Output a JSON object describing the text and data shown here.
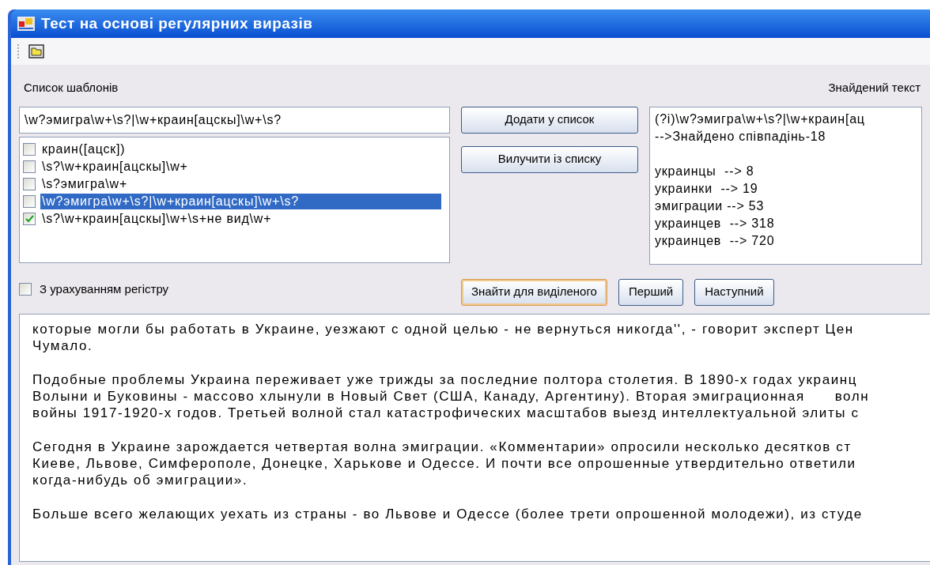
{
  "window": {
    "title": "Тест на основі регулярних виразів"
  },
  "templates": {
    "label": "Список шаблонів",
    "pattern_input": "\\w?эмигра\\w+\\s?|\\w+краин[ацскы]\\w+\\s?",
    "items": [
      {
        "text": "краин([ацск])",
        "checked": false,
        "selected": false
      },
      {
        "text": "\\s?\\w+краин[ацскы]\\w+",
        "checked": false,
        "selected": false
      },
      {
        "text": "\\s?эмигра\\w+",
        "checked": false,
        "selected": false
      },
      {
        "text": "\\w?эмигра\\w+\\s?|\\w+краин[ацскы]\\w+\\s?",
        "checked": false,
        "selected": true
      },
      {
        "text": "\\s?\\w+краин[ацскы]\\w+\\s+не вид\\w+",
        "checked": true,
        "selected": false
      }
    ]
  },
  "list_buttons": [
    "Додати у список",
    "Вилучити із списку"
  ],
  "case_sensitive": {
    "label": "З урахуванням регістру",
    "checked": false
  },
  "found": {
    "label": "Знайдений текст",
    "query_lines": [
      "(?i)\\w?эмигра\\w+\\s?|\\w+краин[ац",
      "-->Знайдено співпадінь-18"
    ],
    "results": [
      "украинцы  --> 8",
      "украинки  --> 19",
      "эмиграции --> 53",
      "украинцев  --> 318",
      "украинцев  --> 720"
    ]
  },
  "action_buttons": [
    {
      "label": "Знайти для виділеного",
      "focused": true
    },
    {
      "label": "Перший",
      "focused": false
    },
    {
      "label": "Наступний",
      "focused": false
    }
  ],
  "text_paragraphs": [
    [
      "которые могли бы работать в Украине, уезжают с одной целью - не вернуться никогда'', - говорит эксперт Цен",
      "Чумало."
    ],
    [
      "Подобные проблемы Украина переживает уже трижды за последние полтора столетия. В 1890-х годах украинц",
      "Волыни и Буковины - массово хлынули в Новый Свет (США, Канаду, Аргентину). Вторая эмиграционная      волн",
      "войны 1917-1920-х годов. Третьей волной стал катастрофических масштабов выезд интеллектуальной элиты с"
    ],
    [
      "Сегодня в Украине зарождается четвертая волна эмиграции. «Комментарии» опросили несколько десятков ст",
      "Киеве, Львове, Симферополе, Донецке, Харькове и Одессе. И почти все опрошенные утвердительно ответили",
      "когда-нибудь об эмиграции»."
    ],
    [
      "Больше всего желающих уехать из страны - во Львове и Одессе (более трети опрошенной молодежи), из студе"
    ]
  ]
}
